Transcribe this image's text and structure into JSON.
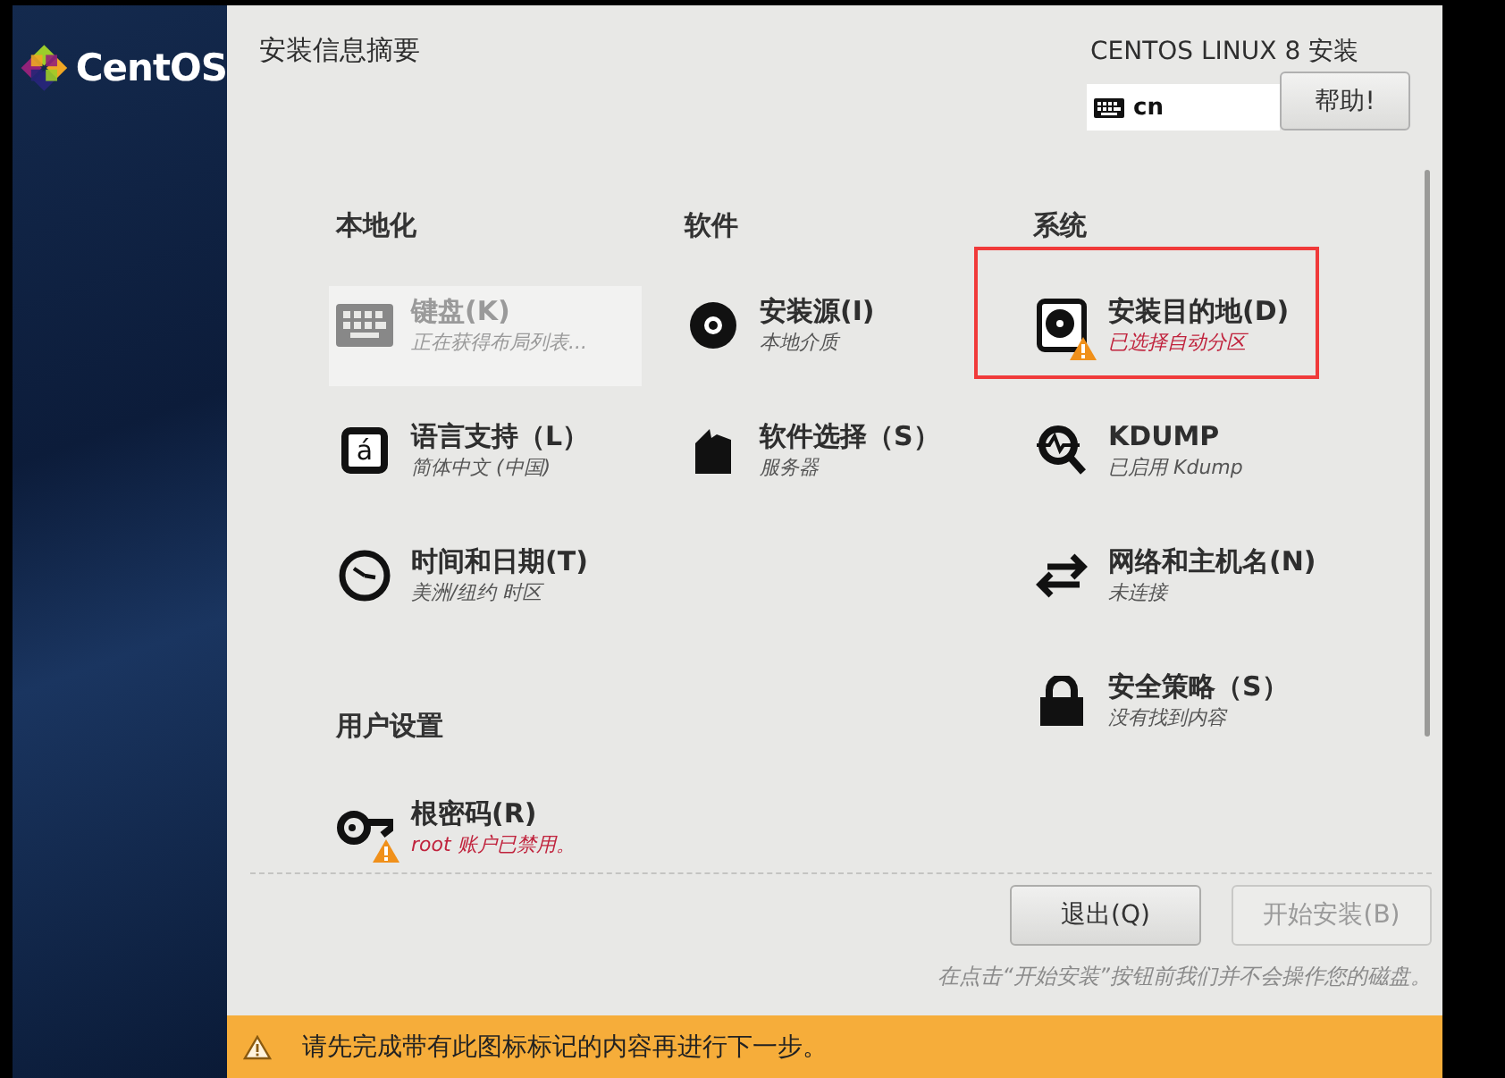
{
  "sidebar": {
    "logo_text": "CentOS"
  },
  "header": {
    "title": "安装信息摘要",
    "product": "CENTOS LINUX 8 安装",
    "keyboard_layout": "cn",
    "help_button": "帮助!"
  },
  "categories": [
    {
      "heading": "本地化",
      "spokes": [
        {
          "kind": "keyboard",
          "title": "键盘(K)",
          "status": "正在获得布局列表...",
          "disabled": true,
          "attention": false,
          "highlighted": false
        },
        {
          "kind": "language",
          "icon_text": "á",
          "title": "语言支持（L）",
          "status": "简体中文 (中国)",
          "disabled": false,
          "attention": false,
          "highlighted": false
        },
        {
          "kind": "clock",
          "title": "时间和日期(T)",
          "status": "美洲/纽约 时区",
          "disabled": false,
          "attention": false,
          "highlighted": false
        }
      ]
    },
    {
      "heading": "软件",
      "spokes": [
        {
          "kind": "disc",
          "title": "安装源(I)",
          "status": "本地介质",
          "disabled": false,
          "attention": false,
          "highlighted": false
        },
        {
          "kind": "package",
          "title": "软件选择（S）",
          "status": "服务器",
          "disabled": false,
          "attention": false,
          "highlighted": false
        }
      ]
    },
    {
      "heading": "系统",
      "spokes": [
        {
          "kind": "harddisk",
          "title": "安装目的地(D)",
          "status": "已选择自动分区",
          "disabled": false,
          "attention": true,
          "highlighted": true
        },
        {
          "kind": "kdump",
          "title": "KDUMP",
          "status": "已启用 Kdump",
          "disabled": false,
          "attention": false,
          "highlighted": false
        },
        {
          "kind": "network",
          "title": "网络和主机名(N)",
          "status": "未连接",
          "disabled": false,
          "attention": false,
          "highlighted": false
        },
        {
          "kind": "lock",
          "title": "安全策略（S）",
          "status": "没有找到内容",
          "disabled": false,
          "attention": false,
          "highlighted": false
        }
      ]
    }
  ],
  "user_settings": {
    "heading": "用户设置",
    "spokes": [
      {
        "kind": "key",
        "title": "根密码(R)",
        "status": "root 账户已禁用。",
        "disabled": false,
        "attention": true,
        "highlighted": false
      }
    ]
  },
  "footer": {
    "buttons": [
      {
        "label": "退出(Q)",
        "disabled": false
      },
      {
        "label": "开始安装(B)",
        "disabled": true
      }
    ],
    "note": "在点击“开始安装”按钮前我们并不会操作您的磁盘。"
  },
  "warning_bar": {
    "text": "请先完成带有此图标标记的内容再进行下一步。"
  }
}
